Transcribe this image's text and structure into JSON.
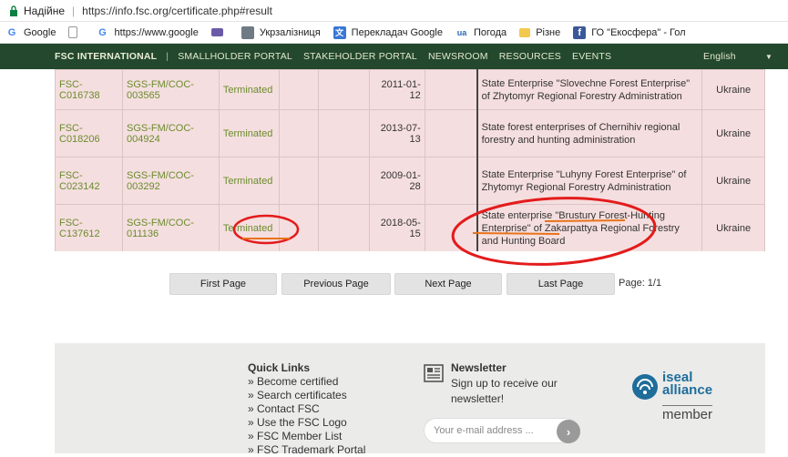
{
  "browser": {
    "secure_label": "Надійне",
    "url": "https://info.fsc.org/certificate.php#result"
  },
  "bookmarks": [
    {
      "label": "Google",
      "icon": "google-icon"
    },
    {
      "label": "",
      "icon": "page-icon"
    },
    {
      "label": "https://www.google",
      "icon": "google-icon"
    },
    {
      "label": "",
      "icon": "mail-icon"
    },
    {
      "label": "Укрзалізниця",
      "icon": "train-icon"
    },
    {
      "label": "Перекладач Google",
      "icon": "translate-icon"
    },
    {
      "label": "Погода",
      "icon": "weather-icon"
    },
    {
      "label": "Різне",
      "icon": "folder-icon"
    },
    {
      "label": "ГО \"Екосфера\" - Гол",
      "icon": "facebook-icon"
    }
  ],
  "nav": {
    "brand": "FSC INTERNATIONAL",
    "divider": "|",
    "links": [
      "SMALLHOLDER PORTAL",
      "STAKEHOLDER PORTAL",
      "NEWSROOM",
      "RESOURCES",
      "EVENTS"
    ],
    "language": "English",
    "caret": "▼"
  },
  "table": {
    "rows": [
      {
        "license": "FSC-C016738",
        "code": "SGS-FM/COC-003565",
        "status": "Terminated",
        "date": "2011-01-12",
        "org": "State Enterprise \"Slovechne Forest Enterprise\" of Zhytomyr Regional Forestry Administration",
        "country": "Ukraine"
      },
      {
        "license": "FSC-C018206",
        "code": "SGS-FM/COC-004924",
        "status": "Terminated",
        "date": "2013-07-13",
        "org": "State forest enterprises of Chernihiv regional forestry and hunting administration",
        "country": "Ukraine"
      },
      {
        "license": "FSC-C023142",
        "code": "SGS-FM/COC-003292",
        "status": "Terminated",
        "date": "2009-01-28",
        "org": "State Enterprise \"Luhyny Forest Enterprise\" of Zhytomyr Regional Forestry Administration",
        "country": "Ukraine"
      },
      {
        "license": "FSC-C137612",
        "code": "SGS-FM/COC-011136",
        "status": "Terminated",
        "date": "2018-05-15",
        "org": "State enterprise \"Brustury Forest-Hunting Enterprise\" of Zakarpattya Regional Forestry and Hunting Board",
        "country": "Ukraine"
      }
    ]
  },
  "pager": {
    "first": "First Page",
    "previous": "Previous Page",
    "next": "Next Page",
    "last": "Last Page",
    "info": "Page: 1/1"
  },
  "footer": {
    "quick_links": {
      "title": "Quick Links",
      "items": [
        "» Become certified",
        "» Search certificates",
        "» Contact FSC",
        "» Use the FSC Logo",
        "» FSC Member List",
        "» FSC Trademark Portal"
      ]
    },
    "newsletter": {
      "title": "Newsletter",
      "description": "Sign up to receive our newsletter!",
      "placeholder": "Your e-mail address ...",
      "go": "›"
    },
    "iseal": {
      "line1": "iseal",
      "line2": "alliance",
      "line3": "member"
    }
  },
  "colors": {
    "nav_bg": "#23482d",
    "row_bg": "#f5dedf",
    "link_green": "#6a8c2d",
    "annotation_red": "#e31b1b",
    "annotation_orange": "#e8731a"
  }
}
